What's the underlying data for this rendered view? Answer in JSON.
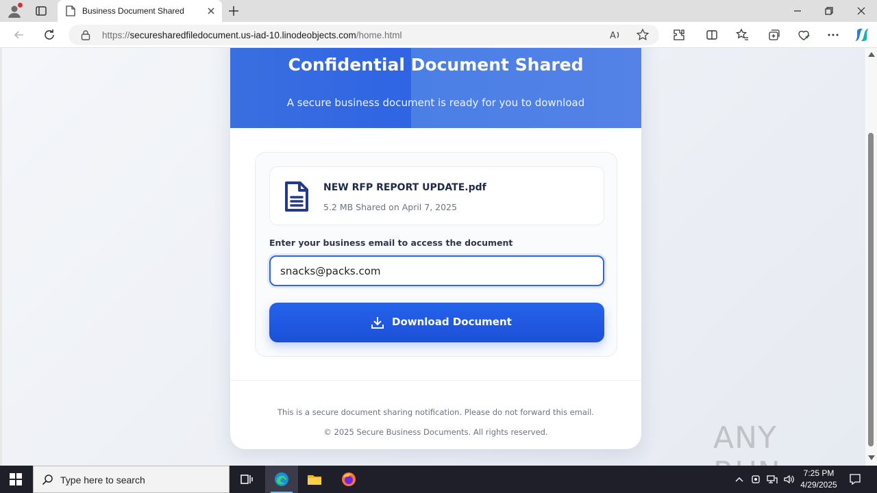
{
  "browser": {
    "tab_title": "Business Document Shared",
    "url_prefix": "https://",
    "url_host": "securesharedfiledocument.us-iad-10.linodeobjects.com",
    "url_path": "/home.html"
  },
  "page": {
    "hero_title": "Confidential Document Shared",
    "hero_subtitle": "A secure business document is ready for you to download",
    "file_name": "NEW RFP REPORT UPDATE.pdf",
    "file_meta": "5.2 MB Shared on April 7, 2025",
    "email_label": "Enter your business email to access the document",
    "email_value": "snacks@packs.com",
    "download_label": "Download Document",
    "footer_notice": "This is a secure document sharing notification. Please do not forward this email.",
    "footer_copyright": "© 2025 Secure Business Documents. All rights reserved."
  },
  "watermark": "ANY RUN",
  "taskbar": {
    "search_placeholder": "Type here to search",
    "time": "7:25 PM",
    "date": "4/29/2025"
  },
  "colors": {
    "accent": "#2563eb",
    "hero": "#3a6fe0",
    "taskbar": "#1f1f2a"
  }
}
